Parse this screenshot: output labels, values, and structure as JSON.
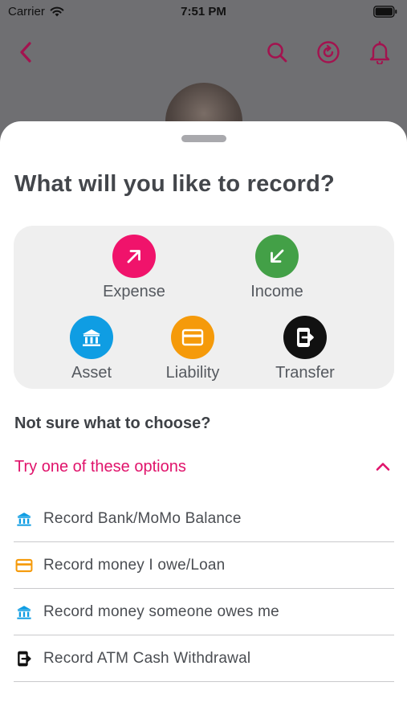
{
  "status_bar": {
    "carrier": "Carrier",
    "time": "7:51 PM"
  },
  "nav": {
    "back_icon": "chevron-left-icon",
    "search_icon": "search-icon",
    "refresh_icon": "refresh-icon",
    "bell_icon": "bell-icon",
    "accent_color": "#c2185b"
  },
  "sheet": {
    "title": "What will you like to record?",
    "options": [
      {
        "label": "Expense",
        "icon": "arrow-up-right-icon",
        "color": "#f0136b"
      },
      {
        "label": "Income",
        "icon": "arrow-down-left-icon",
        "color": "#43a047"
      },
      {
        "label": "Asset",
        "icon": "bank-icon",
        "color": "#0f9de3"
      },
      {
        "label": "Liability",
        "icon": "card-icon",
        "color": "#f59a0a"
      },
      {
        "label": "Transfer",
        "icon": "exit-phone-icon",
        "color": "#111111"
      }
    ],
    "unsure_text": "Not sure what to choose?",
    "try_label": "Try one of these options",
    "try_color": "#e0136b",
    "suggestions": [
      {
        "label": "Record Bank/MoMo Balance",
        "icon": "bank-icon",
        "color": "#0f9de3"
      },
      {
        "label": "Record money I owe/Loan",
        "icon": "card-icon",
        "color": "#f59a0a"
      },
      {
        "label": "Record money someone owes me",
        "icon": "bank-icon",
        "color": "#0f9de3"
      },
      {
        "label": "Record ATM Cash Withdrawal",
        "icon": "exit-phone-icon",
        "color": "#111111"
      }
    ]
  }
}
